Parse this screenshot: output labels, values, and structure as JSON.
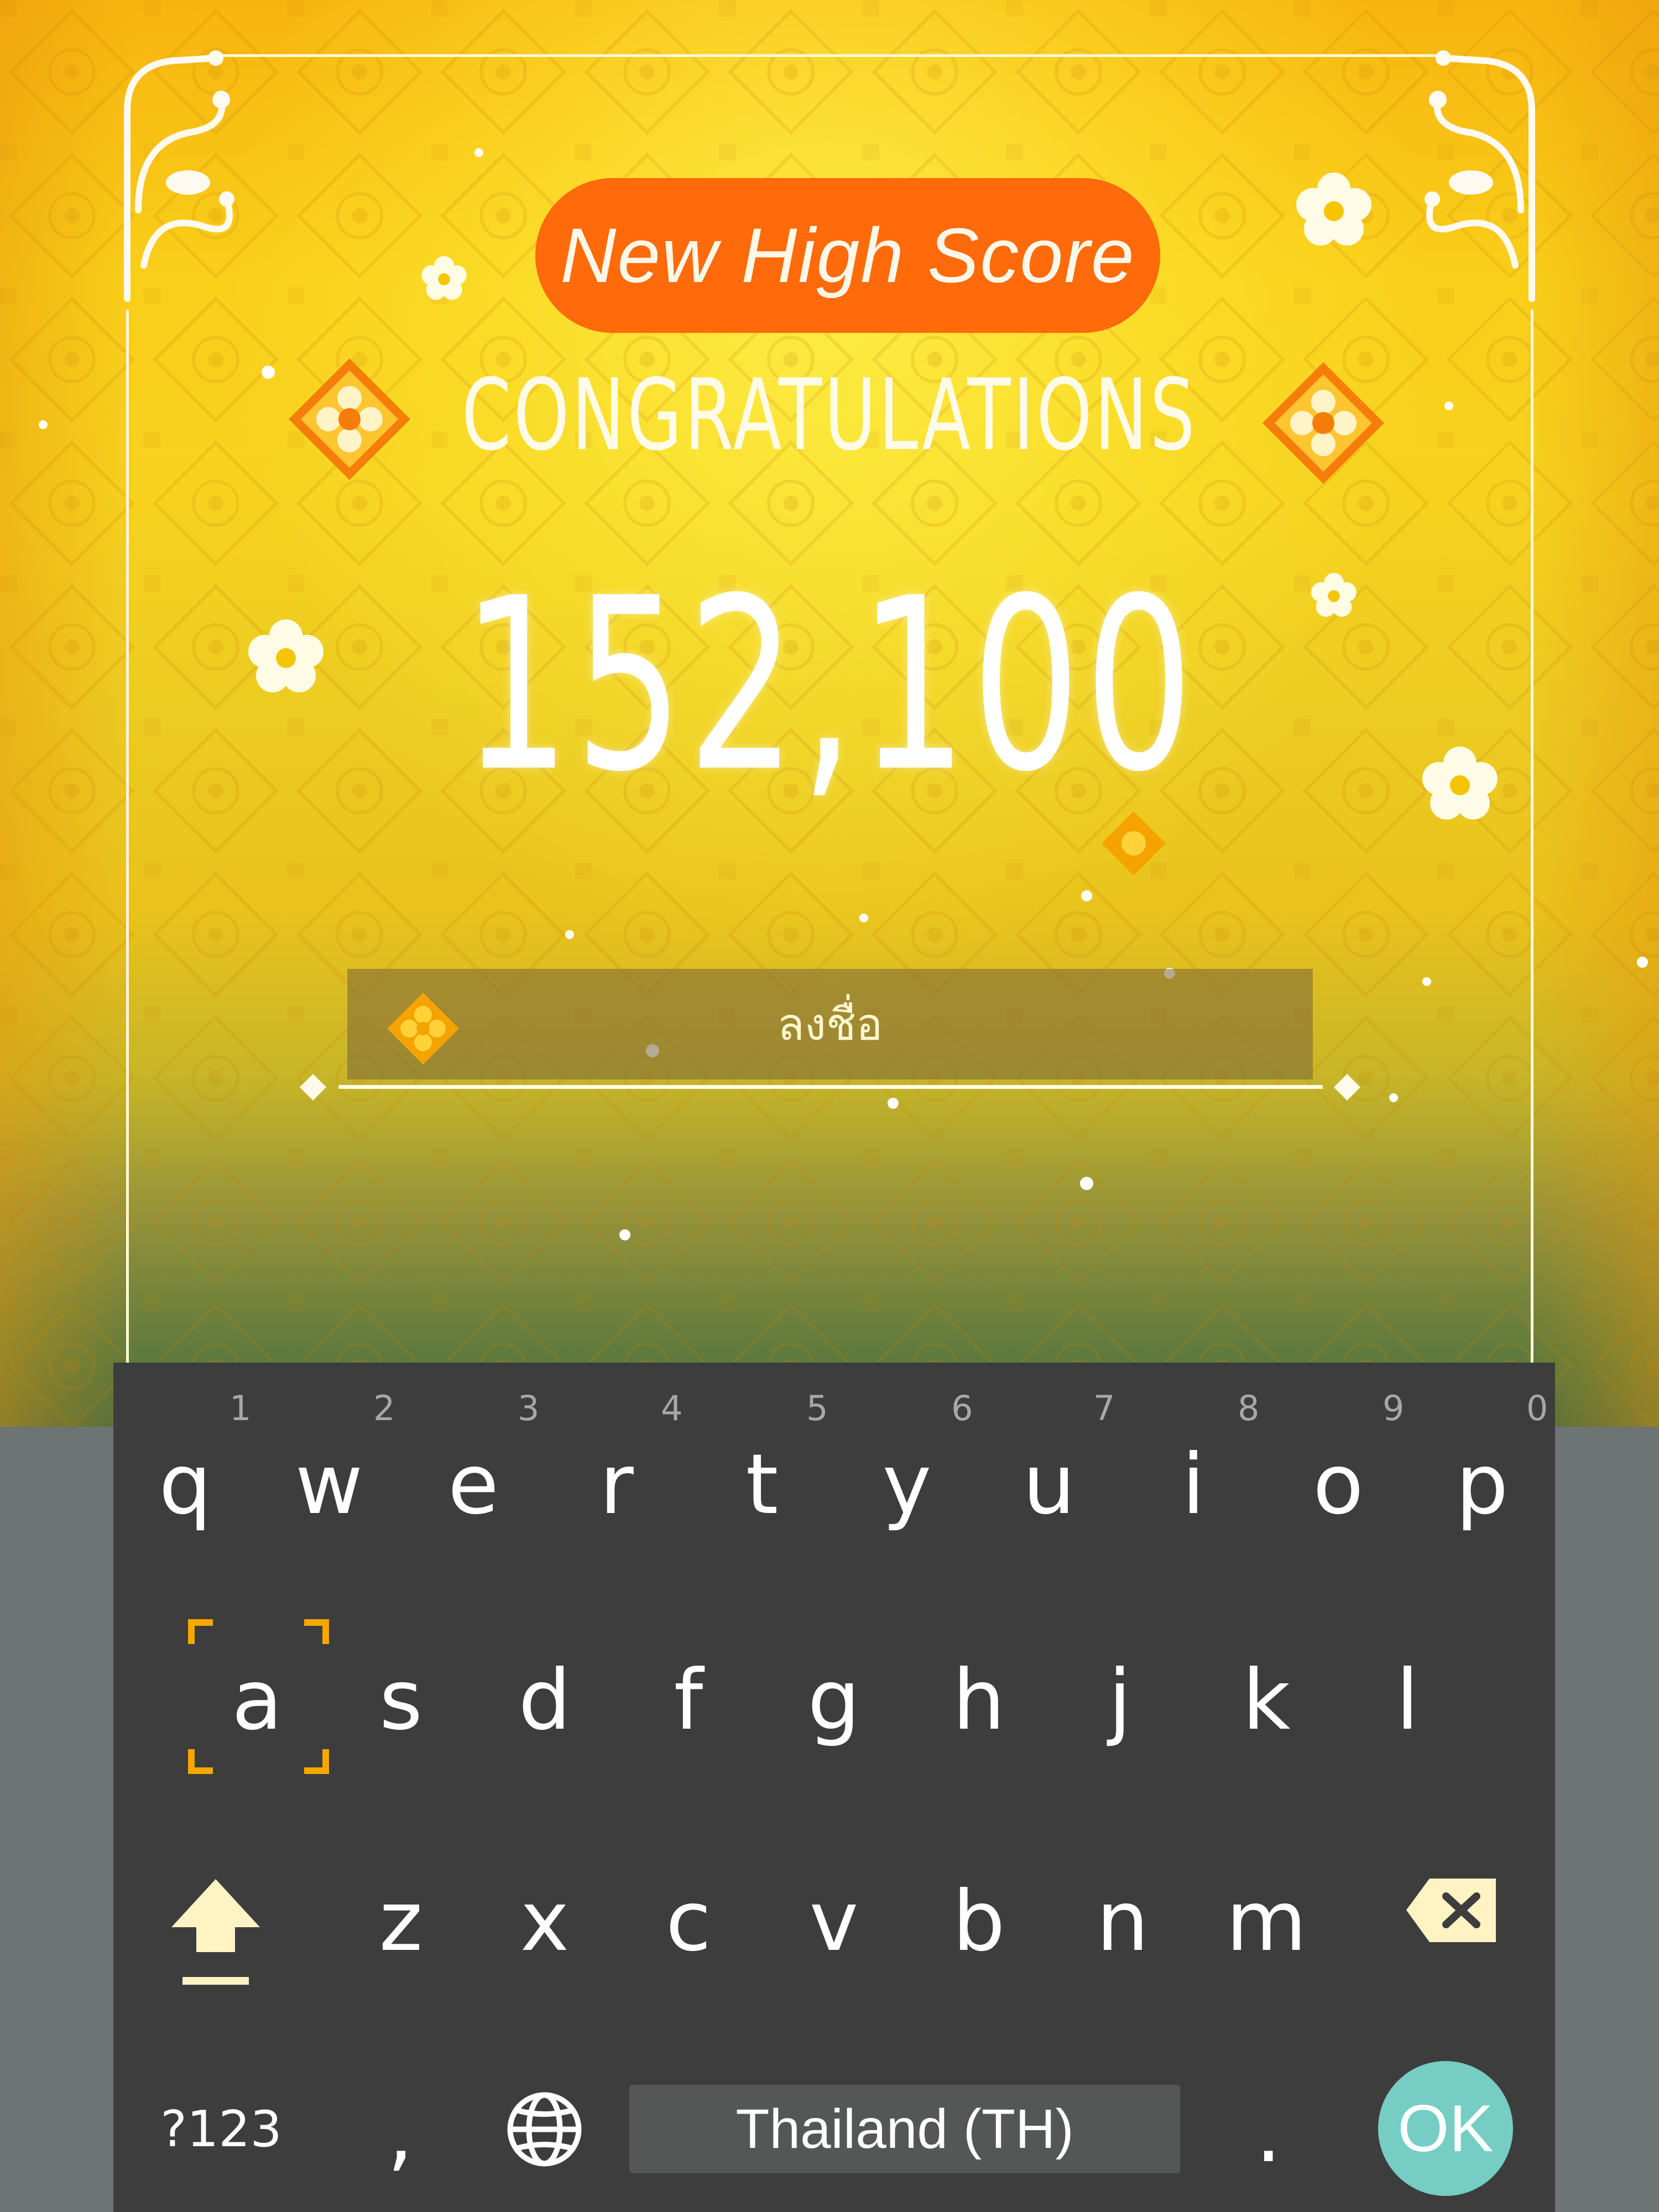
{
  "game": {
    "badge": "New High Score",
    "heading": "CONGRATULATIONS",
    "score": "152,100",
    "name_placeholder": "ลงชื่อ"
  },
  "keyboard": {
    "row1": [
      {
        "key": "q",
        "hint": "1"
      },
      {
        "key": "w",
        "hint": "2"
      },
      {
        "key": "e",
        "hint": "3"
      },
      {
        "key": "r",
        "hint": "4"
      },
      {
        "key": "t",
        "hint": "5"
      },
      {
        "key": "y",
        "hint": "6"
      },
      {
        "key": "u",
        "hint": "7"
      },
      {
        "key": "i",
        "hint": "8"
      },
      {
        "key": "o",
        "hint": "9"
      },
      {
        "key": "p",
        "hint": "0"
      }
    ],
    "row2": [
      "a",
      "s",
      "d",
      "f",
      "g",
      "h",
      "j",
      "k",
      "l"
    ],
    "row3": [
      "z",
      "x",
      "c",
      "v",
      "b",
      "n",
      "m"
    ],
    "symbols_label": "?123",
    "comma": ",",
    "period": ".",
    "space_label": "Thailand (TH)",
    "ok_label": "OK",
    "focused_key": "a",
    "icons": [
      "shift-icon",
      "backspace-icon",
      "globe-icon"
    ]
  },
  "colors": {
    "badge": "#ff6a0a",
    "keyboard_bg": "#3d3d3d",
    "ok_button": "#75cdc3",
    "focus_bracket": "#f6a800",
    "shift_icon": "#fff3c4"
  }
}
